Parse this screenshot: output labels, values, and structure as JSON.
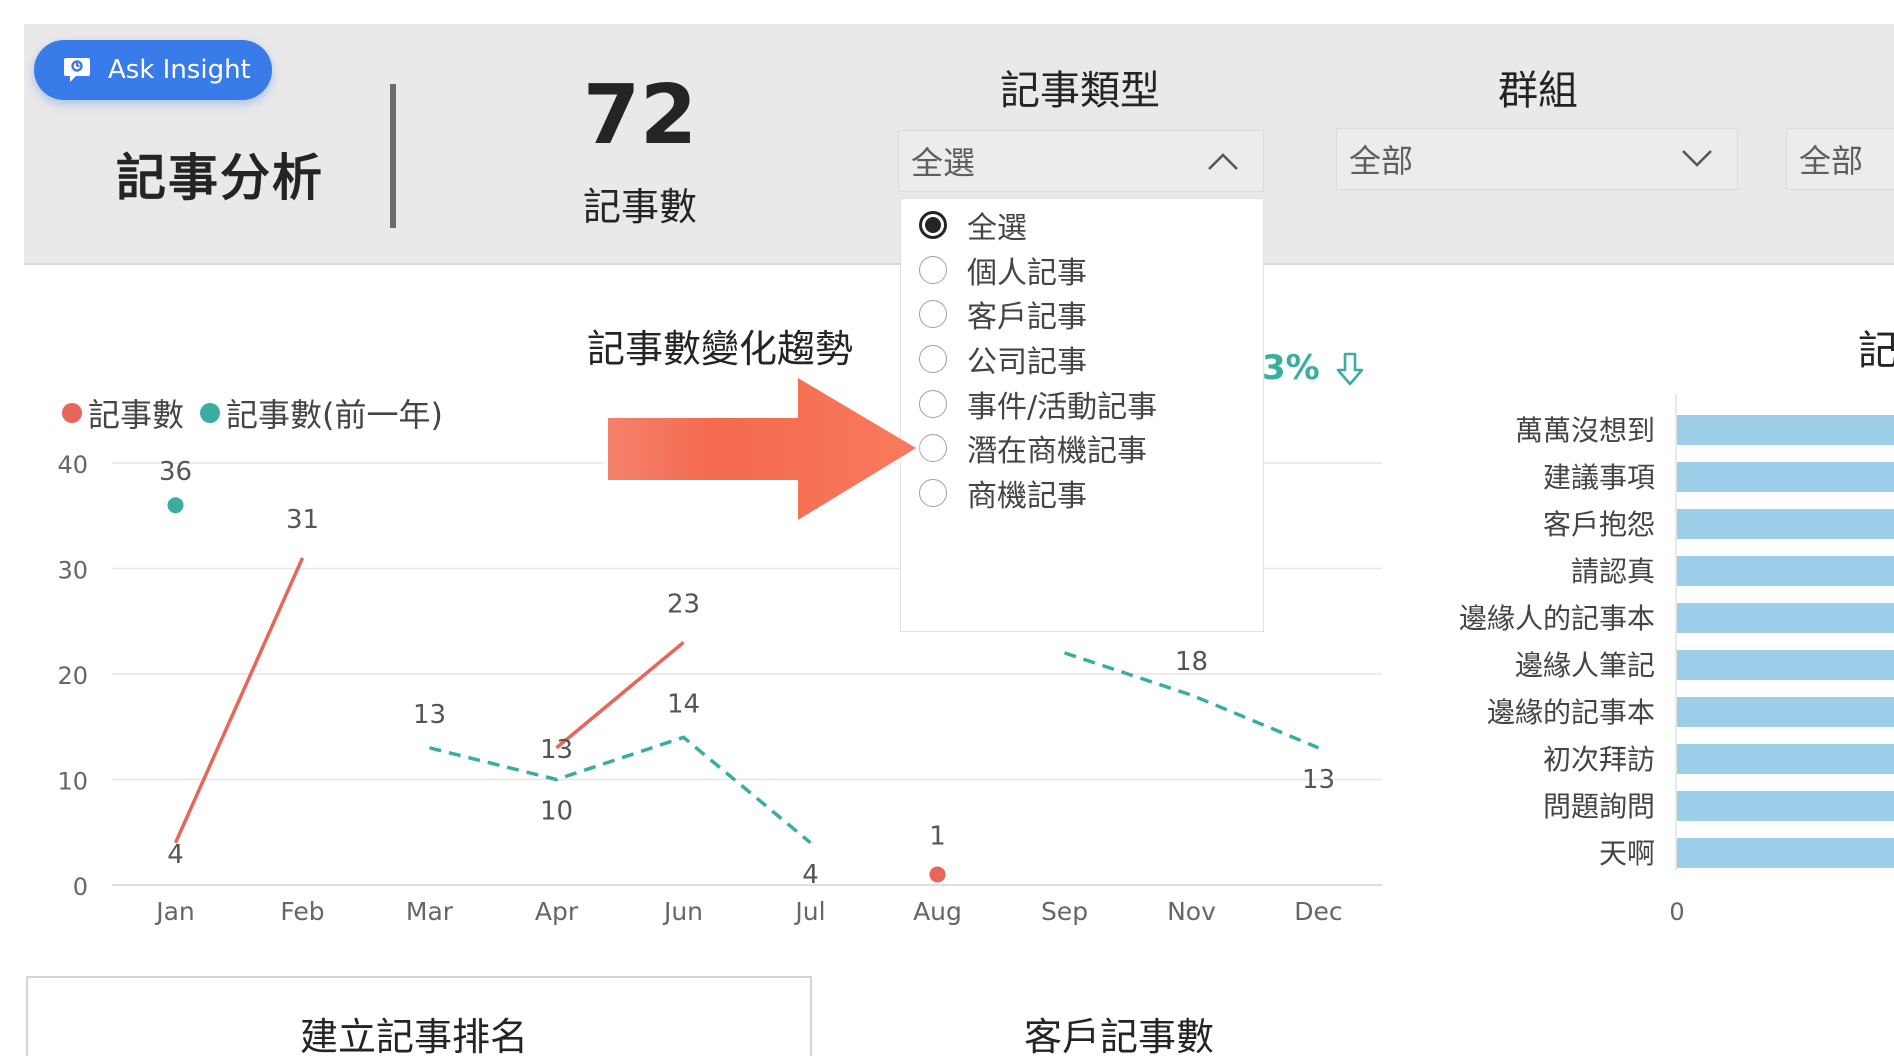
{
  "ask_insight": {
    "label": "Ask Insight"
  },
  "header": {
    "title": "記事分析",
    "kpi_value": "72",
    "kpi_label": "記事數"
  },
  "slicers": [
    {
      "title": "記事類型",
      "value": "全選",
      "expanded": true,
      "options": [
        {
          "label": "全選",
          "checked": true
        },
        {
          "label": "個人記事",
          "checked": false
        },
        {
          "label": "客戶記事",
          "checked": false
        },
        {
          "label": "公司記事",
          "checked": false
        },
        {
          "label": "事件/活動記事",
          "checked": false
        },
        {
          "label": "潛在商機記事",
          "checked": false
        },
        {
          "label": "商機記事",
          "checked": false
        }
      ]
    },
    {
      "title": "群組",
      "value": "全部",
      "expanded": false
    },
    {
      "title": "",
      "value": "全部",
      "expanded": false
    }
  ],
  "trend_indicator": {
    "text": "3%",
    "arrow": "arrow-down-icon",
    "color": "#3aada0"
  },
  "bar_chart": {
    "title": "記"
  },
  "bottom": {
    "ranking_title": "建立記事排名",
    "customer_title": "客戶記事數"
  },
  "colors": {
    "current": "#e8655a",
    "previous": "#3aada0",
    "bar": "#9ccde9",
    "accent": "#3a7bea"
  },
  "chart_data": [
    {
      "type": "line",
      "title": "記事數變化趨勢",
      "categories": [
        "Jan",
        "Feb",
        "Mar",
        "Apr",
        "Jun",
        "Jul",
        "Aug",
        "Sep",
        "Nov",
        "Dec"
      ],
      "series": [
        {
          "name": "記事數",
          "values": [
            4,
            31,
            null,
            13,
            23,
            null,
            1,
            null,
            null,
            null
          ]
        },
        {
          "name": "記事數(前一年)",
          "values": [
            36,
            null,
            13,
            10,
            14,
            4,
            null,
            22,
            18,
            13
          ]
        }
      ],
      "data_labels": {
        "current": [
          "4",
          "31",
          "",
          "13",
          "23",
          "",
          "1",
          "",
          "",
          ""
        ],
        "previous": [
          "36",
          "",
          "13",
          "10",
          "14",
          "4",
          "",
          "",
          "18",
          "13"
        ]
      },
      "ylim": [
        0,
        40
      ],
      "yticks": [
        0,
        10,
        20,
        30,
        40
      ],
      "grid": true,
      "legend": "top-left"
    },
    {
      "type": "bar",
      "orientation": "horizontal",
      "categories": [
        "萬萬沒想到",
        "建議事項",
        "客戶抱怨",
        "請認真",
        "邊緣人的記事本",
        "邊緣人筆記",
        "邊緣的記事本",
        "初次拜訪",
        "問題詢問",
        "天啊"
      ],
      "xticks": [
        0
      ]
    }
  ]
}
